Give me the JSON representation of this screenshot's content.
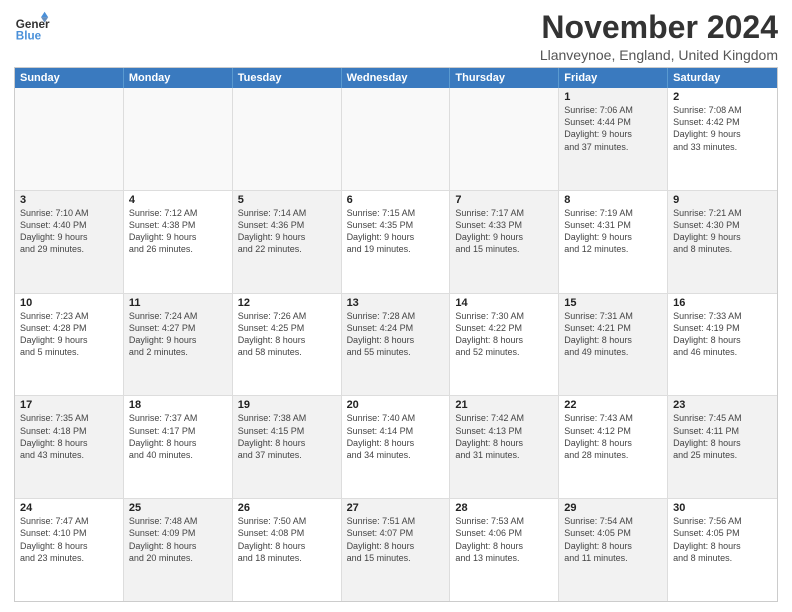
{
  "logo": {
    "text1": "General",
    "text2": "Blue"
  },
  "title": "November 2024",
  "location": "Llanveynoe, England, United Kingdom",
  "headers": [
    "Sunday",
    "Monday",
    "Tuesday",
    "Wednesday",
    "Thursday",
    "Friday",
    "Saturday"
  ],
  "rows": [
    [
      {
        "day": "",
        "info": "",
        "empty": true
      },
      {
        "day": "",
        "info": "",
        "empty": true
      },
      {
        "day": "",
        "info": "",
        "empty": true
      },
      {
        "day": "",
        "info": "",
        "empty": true
      },
      {
        "day": "",
        "info": "",
        "empty": true
      },
      {
        "day": "1",
        "info": "Sunrise: 7:06 AM\nSunset: 4:44 PM\nDaylight: 9 hours\nand 37 minutes.",
        "shaded": true
      },
      {
        "day": "2",
        "info": "Sunrise: 7:08 AM\nSunset: 4:42 PM\nDaylight: 9 hours\nand 33 minutes.",
        "shaded": false
      }
    ],
    [
      {
        "day": "3",
        "info": "Sunrise: 7:10 AM\nSunset: 4:40 PM\nDaylight: 9 hours\nand 29 minutes.",
        "shaded": true
      },
      {
        "day": "4",
        "info": "Sunrise: 7:12 AM\nSunset: 4:38 PM\nDaylight: 9 hours\nand 26 minutes.",
        "shaded": false
      },
      {
        "day": "5",
        "info": "Sunrise: 7:14 AM\nSunset: 4:36 PM\nDaylight: 9 hours\nand 22 minutes.",
        "shaded": true
      },
      {
        "day": "6",
        "info": "Sunrise: 7:15 AM\nSunset: 4:35 PM\nDaylight: 9 hours\nand 19 minutes.",
        "shaded": false
      },
      {
        "day": "7",
        "info": "Sunrise: 7:17 AM\nSunset: 4:33 PM\nDaylight: 9 hours\nand 15 minutes.",
        "shaded": true
      },
      {
        "day": "8",
        "info": "Sunrise: 7:19 AM\nSunset: 4:31 PM\nDaylight: 9 hours\nand 12 minutes.",
        "shaded": false
      },
      {
        "day": "9",
        "info": "Sunrise: 7:21 AM\nSunset: 4:30 PM\nDaylight: 9 hours\nand 8 minutes.",
        "shaded": true
      }
    ],
    [
      {
        "day": "10",
        "info": "Sunrise: 7:23 AM\nSunset: 4:28 PM\nDaylight: 9 hours\nand 5 minutes.",
        "shaded": false
      },
      {
        "day": "11",
        "info": "Sunrise: 7:24 AM\nSunset: 4:27 PM\nDaylight: 9 hours\nand 2 minutes.",
        "shaded": true
      },
      {
        "day": "12",
        "info": "Sunrise: 7:26 AM\nSunset: 4:25 PM\nDaylight: 8 hours\nand 58 minutes.",
        "shaded": false
      },
      {
        "day": "13",
        "info": "Sunrise: 7:28 AM\nSunset: 4:24 PM\nDaylight: 8 hours\nand 55 minutes.",
        "shaded": true
      },
      {
        "day": "14",
        "info": "Sunrise: 7:30 AM\nSunset: 4:22 PM\nDaylight: 8 hours\nand 52 minutes.",
        "shaded": false
      },
      {
        "day": "15",
        "info": "Sunrise: 7:31 AM\nSunset: 4:21 PM\nDaylight: 8 hours\nand 49 minutes.",
        "shaded": true
      },
      {
        "day": "16",
        "info": "Sunrise: 7:33 AM\nSunset: 4:19 PM\nDaylight: 8 hours\nand 46 minutes.",
        "shaded": false
      }
    ],
    [
      {
        "day": "17",
        "info": "Sunrise: 7:35 AM\nSunset: 4:18 PM\nDaylight: 8 hours\nand 43 minutes.",
        "shaded": true
      },
      {
        "day": "18",
        "info": "Sunrise: 7:37 AM\nSunset: 4:17 PM\nDaylight: 8 hours\nand 40 minutes.",
        "shaded": false
      },
      {
        "day": "19",
        "info": "Sunrise: 7:38 AM\nSunset: 4:15 PM\nDaylight: 8 hours\nand 37 minutes.",
        "shaded": true
      },
      {
        "day": "20",
        "info": "Sunrise: 7:40 AM\nSunset: 4:14 PM\nDaylight: 8 hours\nand 34 minutes.",
        "shaded": false
      },
      {
        "day": "21",
        "info": "Sunrise: 7:42 AM\nSunset: 4:13 PM\nDaylight: 8 hours\nand 31 minutes.",
        "shaded": true
      },
      {
        "day": "22",
        "info": "Sunrise: 7:43 AM\nSunset: 4:12 PM\nDaylight: 8 hours\nand 28 minutes.",
        "shaded": false
      },
      {
        "day": "23",
        "info": "Sunrise: 7:45 AM\nSunset: 4:11 PM\nDaylight: 8 hours\nand 25 minutes.",
        "shaded": true
      }
    ],
    [
      {
        "day": "24",
        "info": "Sunrise: 7:47 AM\nSunset: 4:10 PM\nDaylight: 8 hours\nand 23 minutes.",
        "shaded": false
      },
      {
        "day": "25",
        "info": "Sunrise: 7:48 AM\nSunset: 4:09 PM\nDaylight: 8 hours\nand 20 minutes.",
        "shaded": true
      },
      {
        "day": "26",
        "info": "Sunrise: 7:50 AM\nSunset: 4:08 PM\nDaylight: 8 hours\nand 18 minutes.",
        "shaded": false
      },
      {
        "day": "27",
        "info": "Sunrise: 7:51 AM\nSunset: 4:07 PM\nDaylight: 8 hours\nand 15 minutes.",
        "shaded": true
      },
      {
        "day": "28",
        "info": "Sunrise: 7:53 AM\nSunset: 4:06 PM\nDaylight: 8 hours\nand 13 minutes.",
        "shaded": false
      },
      {
        "day": "29",
        "info": "Sunrise: 7:54 AM\nSunset: 4:05 PM\nDaylight: 8 hours\nand 11 minutes.",
        "shaded": true
      },
      {
        "day": "30",
        "info": "Sunrise: 7:56 AM\nSunset: 4:05 PM\nDaylight: 8 hours\nand 8 minutes.",
        "shaded": false
      }
    ]
  ]
}
